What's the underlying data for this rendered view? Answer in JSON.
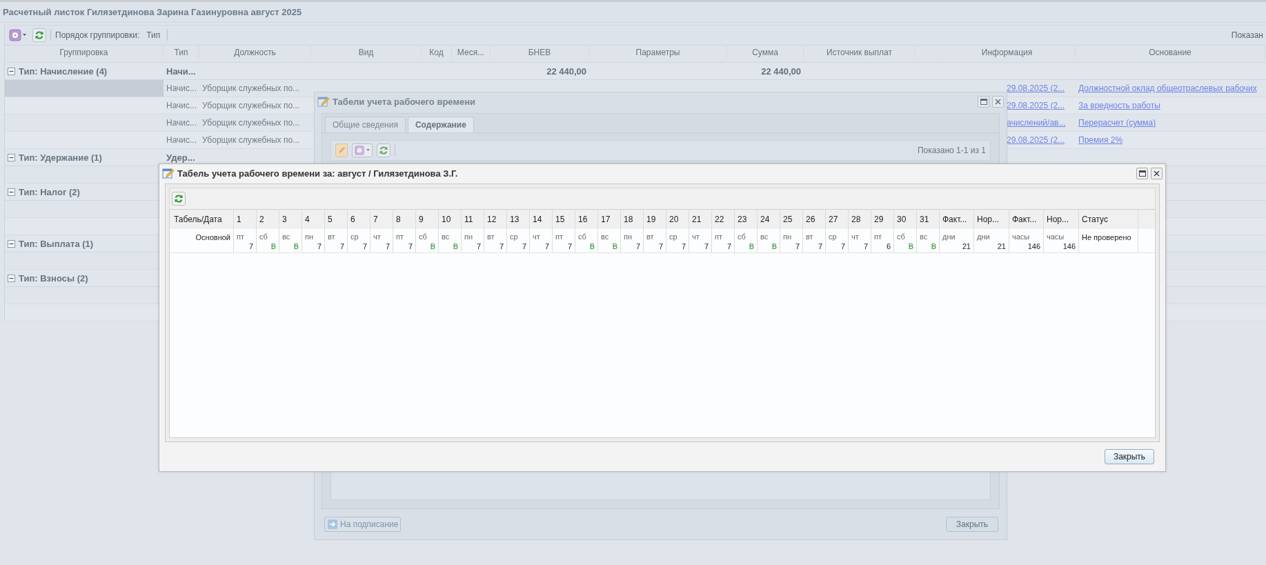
{
  "window": {
    "title": "Расчетный листок Гилязетдинова Зарина Газинуровна август 2025"
  },
  "toolbar": {
    "grouping_label": "Порядок группировки:",
    "grouping_value": "Тип",
    "paging": "Показан"
  },
  "grid": {
    "columns": [
      "Группировка",
      "Тип",
      "Должность",
      "Вид",
      "Код",
      "Меся...",
      "БНЕВ",
      "Параметры",
      "Сумма",
      "Источник выплат",
      "Информация",
      "Основание"
    ],
    "groups": [
      {
        "label": "Тип: Начисление (4)",
        "expanded": true,
        "type_cell": "Начи...",
        "bnev": "22 440,00",
        "sum": "22 440,00",
        "rows": [
          {
            "type": "Начис...",
            "position": "Уборщик служебных по...",
            "info": "29.08.2025 (2...",
            "basis": "Должностной оклад общеотраслевых рабочих",
            "selected": true
          },
          {
            "type": "Начис...",
            "position": "Уборщик служебных по...",
            "info": "29.08.2025 (2...",
            "basis": "За вредность работы",
            "selected": false
          },
          {
            "type": "Начис...",
            "position": "Уборщик служебных по...",
            "info": "ачислений/ав...",
            "basis": "Перерасчет (сумма)",
            "selected": false
          },
          {
            "type": "Начис...",
            "position": "Уборщик служебных по...",
            "info": "29.08.2025 (2...",
            "basis": "Премия 2%",
            "selected": false
          }
        ]
      },
      {
        "label": "Тип: Удержание (1)",
        "expanded": true,
        "type_cell": "Удер...",
        "rows": [
          {
            "selected": false
          }
        ]
      },
      {
        "label": "Тип: Налог (2)",
        "expanded": true,
        "rows": [
          {
            "selected": false
          },
          {
            "selected": false
          }
        ]
      },
      {
        "label": "Тип: Выплата (1)",
        "expanded": true,
        "rows": [
          {
            "selected": false
          }
        ]
      },
      {
        "label": "Тип: Взносы (2)",
        "expanded": true,
        "rows": [
          {
            "selected": false
          },
          {
            "selected": false
          }
        ]
      }
    ]
  },
  "timesheets_dialog": {
    "title": "Табели учета рабочего времени",
    "tabs": [
      {
        "label": "Общие сведения",
        "selected": false
      },
      {
        "label": "Содержание",
        "selected": true
      }
    ],
    "paging": "Показано 1-1 из 1",
    "buttons": [
      {
        "label": "На подписание",
        "disabled": true
      },
      {
        "label": "Закрыть",
        "disabled": false
      }
    ]
  },
  "timesheet_dialog": {
    "title": "Табель учета рабочего времени за: август / Гилязетдинова З.Г.",
    "first_column": "Табель/Дата",
    "total_columns": [
      "Факт...",
      "Нор...",
      "Факт...",
      "Нор..."
    ],
    "status_column": "Статус",
    "row": {
      "label": "Основной",
      "days": [
        {
          "date": "1",
          "dow": "пт",
          "value": "7",
          "kind": "work"
        },
        {
          "date": "2",
          "dow": "сб",
          "value": "В",
          "kind": "off"
        },
        {
          "date": "3",
          "dow": "вс",
          "value": "В",
          "kind": "off"
        },
        {
          "date": "4",
          "dow": "пн",
          "value": "7",
          "kind": "work"
        },
        {
          "date": "5",
          "dow": "вт",
          "value": "7",
          "kind": "work"
        },
        {
          "date": "6",
          "dow": "ср",
          "value": "7",
          "kind": "work"
        },
        {
          "date": "7",
          "dow": "чт",
          "value": "7",
          "kind": "work"
        },
        {
          "date": "8",
          "dow": "пт",
          "value": "7",
          "kind": "work"
        },
        {
          "date": "9",
          "dow": "сб",
          "value": "В",
          "kind": "off"
        },
        {
          "date": "10",
          "dow": "вс",
          "value": "В",
          "kind": "off"
        },
        {
          "date": "11",
          "dow": "пн",
          "value": "7",
          "kind": "work"
        },
        {
          "date": "12",
          "dow": "вт",
          "value": "7",
          "kind": "work"
        },
        {
          "date": "13",
          "dow": "ср",
          "value": "7",
          "kind": "work"
        },
        {
          "date": "14",
          "dow": "чт",
          "value": "7",
          "kind": "work"
        },
        {
          "date": "15",
          "dow": "пт",
          "value": "7",
          "kind": "work"
        },
        {
          "date": "16",
          "dow": "сб",
          "value": "В",
          "kind": "off"
        },
        {
          "date": "17",
          "dow": "вс",
          "value": "В",
          "kind": "off"
        },
        {
          "date": "18",
          "dow": "пн",
          "value": "7",
          "kind": "work"
        },
        {
          "date": "19",
          "dow": "вт",
          "value": "7",
          "kind": "work"
        },
        {
          "date": "20",
          "dow": "ср",
          "value": "7",
          "kind": "work"
        },
        {
          "date": "21",
          "dow": "чт",
          "value": "7",
          "kind": "work"
        },
        {
          "date": "22",
          "dow": "пт",
          "value": "7",
          "kind": "work"
        },
        {
          "date": "23",
          "dow": "сб",
          "value": "В",
          "kind": "off"
        },
        {
          "date": "24",
          "dow": "вс",
          "value": "В",
          "kind": "off"
        },
        {
          "date": "25",
          "dow": "пн",
          "value": "7",
          "kind": "work"
        },
        {
          "date": "26",
          "dow": "вт",
          "value": "7",
          "kind": "work"
        },
        {
          "date": "27",
          "dow": "ср",
          "value": "7",
          "kind": "work"
        },
        {
          "date": "28",
          "dow": "чт",
          "value": "7",
          "kind": "work"
        },
        {
          "date": "29",
          "dow": "пт",
          "value": "6",
          "kind": "work"
        },
        {
          "date": "30",
          "dow": "сб",
          "value": "В",
          "kind": "off"
        },
        {
          "date": "31",
          "dow": "вс",
          "value": "В",
          "kind": "off"
        }
      ],
      "totals": [
        {
          "unit": "дни",
          "value": "21"
        },
        {
          "unit": "дни",
          "value": "21"
        },
        {
          "unit": "часы",
          "value": "146"
        },
        {
          "unit": "часы",
          "value": "146"
        }
      ],
      "status": "Не проверено"
    },
    "close_button": "Закрыть"
  }
}
